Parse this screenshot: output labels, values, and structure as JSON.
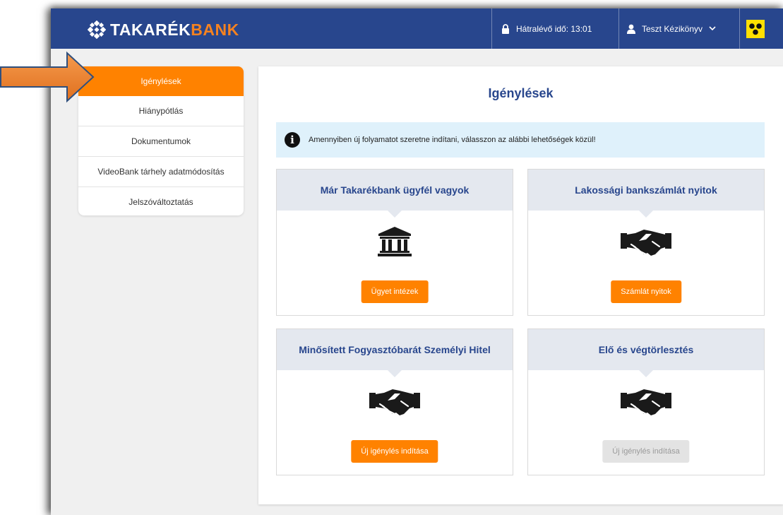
{
  "header": {
    "logo": {
      "part1": "TAKARÉK",
      "part2": "BANK"
    },
    "timer_label": "Hátralévő idő: 13:01",
    "user_name": "Teszt Kézikönyv",
    "icons": {
      "lock": "lock-icon",
      "user": "user-icon",
      "chevron": "chevron-down-icon",
      "accessibility": "accessibility-icon"
    }
  },
  "sidebar": {
    "items": [
      {
        "label": "Igénylések",
        "active": true
      },
      {
        "label": "Hiánypótlás"
      },
      {
        "label": "Dokumentumok"
      },
      {
        "label": "VideoBank tárhely adatmódosítás"
      },
      {
        "label": "Jelszóváltoztatás"
      }
    ]
  },
  "main": {
    "title": "Igénylések",
    "info_text": "Amennyiben új folyamatot szeretne indítani, válasszon az alábbi lehetőségek közül!",
    "cards": [
      {
        "title": "Már Takarékbank ügyfél vagyok",
        "icon": "bank-icon",
        "button": "Ügyet intézek",
        "enabled": true
      },
      {
        "title": "Lakossági bankszámlát nyitok",
        "icon": "handshake-icon",
        "button": "Számlát nyitok",
        "enabled": true
      },
      {
        "title": "Minősített Fogyasztóbarát Személyi Hitel",
        "icon": "handshake-icon",
        "button": "Új igénylés indítása",
        "enabled": true
      },
      {
        "title": "Elő és végtörlesztés",
        "icon": "handshake-icon",
        "button": "Új igénylés indítása",
        "enabled": false
      }
    ]
  },
  "colors": {
    "header_bg": "#28468d",
    "accent_orange": "#ff8200",
    "title_blue": "#28468d",
    "info_bg": "#dff1fb",
    "card_head_bg": "#e4e8ef",
    "accessibility_yellow": "#ffe000"
  }
}
